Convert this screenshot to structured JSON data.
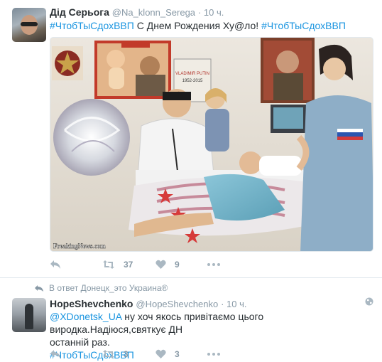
{
  "tweets": [
    {
      "author": {
        "name": "Дід Серьога",
        "handle": "@Na_klonn_Serega",
        "time": "· 10 ч."
      },
      "text": {
        "tag": "#ЧтобТыСдохВВП",
        "body": " С Днем Рождения Ху@ло! ",
        "tag2": "#ЧтобТыСдохВВП"
      },
      "media": {
        "poster_name": "VLADIMIR PUTIN",
        "poster_years": "1952-2015",
        "watermark": "FreakingNews.com"
      },
      "actions": {
        "reply_count": "",
        "retweet_count": "37",
        "like_count": "9"
      }
    },
    {
      "context": "В ответ Донецк_это Украина®",
      "author": {
        "name": "HopeShevchenko",
        "handle": "@HopeShevchenko",
        "time": "· 10 ч."
      },
      "text": {
        "mention": "@XDonetsk_UA",
        "body_line1": " ну хоч якось привітаємо цього виродка.Надіюся,святкує ДН",
        "body_line2": "останній раз.",
        "tag": "#ЧтобТыСдохВВП"
      },
      "actions": {
        "reply_count": "",
        "retweet_count": "3",
        "like_count": "3"
      }
    }
  ],
  "icons": {
    "reply": "reply-icon",
    "retweet": "retweet-icon",
    "like": "heart-icon",
    "more": "more-dots-icon",
    "context": "reply-arrow-icon",
    "globe": "globe-icon"
  },
  "colors": {
    "link": "#1b95e0",
    "meta": "#8899a6",
    "text": "#292f33",
    "border": "#e1e8ed"
  }
}
